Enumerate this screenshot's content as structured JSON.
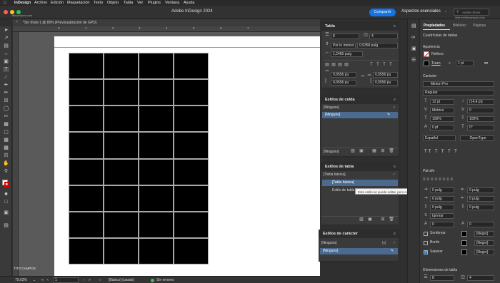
{
  "menubar": {
    "apple": "",
    "items": [
      "InDesign",
      "Archivo",
      "Edición",
      "Maquetación",
      "Texto",
      "Objeto",
      "Tabla",
      "Ver",
      "Plugins",
      "Ventana",
      "Ayuda"
    ]
  },
  "appbar": {
    "title": "Adobe InDesign 2024",
    "share_label": "Compartir",
    "workspace_label": "Aspectos esenciales",
    "search_placeholder": "Adobe Stock",
    "watermark_left": "titocampos.com",
    "watermark_right": "linkt.ee/titocampos.com"
  },
  "document_tab": {
    "label": "*Sin título-1 @ 80% [Previsualización de GPU]"
  },
  "ruler": {
    "marks": [
      "0",
      "1",
      "2",
      "3",
      "4",
      "5",
      "6",
      "7"
    ]
  },
  "table_grid": {
    "rows": 8,
    "columns": 4
  },
  "page": {
    "footer_text": "TITO CAMPOS"
  },
  "status": {
    "zoom": "79,63%",
    "page": "1",
    "style": "[Básico] (usado)",
    "preflight": "Sin errores"
  },
  "tabla_panel": {
    "title": "Tabla",
    "rows_value": "8",
    "cols_value": "4",
    "row_height_mode": "Por lo menos",
    "row_height_value": "0,9358 pulg",
    "col_width_value": "1,2465 pulg",
    "inset_top": "0,0556 pu",
    "inset_bottom": "0,0556 pu",
    "inset_left": "0,0556 pu",
    "inset_right": "0,0556 pu"
  },
  "cell_styles_panel": {
    "title": "Estilos de celda",
    "current": "[Ninguno]",
    "selected_item": "[Ninguno]",
    "footer_value": "[Ninguno]"
  },
  "table_styles_panel": {
    "title": "Estilos de tabla",
    "current": "[Tabla básica]",
    "selected_item": "[Tabla básica]",
    "item2": "Estilo de tabla 1",
    "tooltip": "Este estilo se puede editar, pero no quitar."
  },
  "char_styles_panel": {
    "title": "Estilos de carácter",
    "current": "[Ninguno]",
    "selected_item": "[Ninguno]",
    "shortcut": "[x]"
  },
  "properties": {
    "tabs": [
      "Propiedades",
      "Bibliotec",
      "Páginas"
    ],
    "context_label": "Cuadrículas de tablas",
    "appearance_heading": "Apariencia",
    "fill_label": "Relleno",
    "stroke_label": "Trazo",
    "stroke_weight": "1 pt",
    "character_heading": "Carácter",
    "font_family": "Minion Pro",
    "font_style": "Regular",
    "font_size": "12 pt",
    "leading": "(14,4 pt)",
    "kerning": "Métrico",
    "tracking": "0",
    "vertical_scale": "100%",
    "horizontal_scale": "100%",
    "baseline_shift": "0 pt",
    "skew": "0°",
    "language": "Español",
    "opentype_label": "OpenType",
    "paragraph_heading": "Párrafo",
    "indent_left": "0 pulg",
    "indent_right": "0 pulg",
    "first_line": "0 pulg",
    "last_line": "0 pulg",
    "space_before": "0 pulg",
    "space_after": "0 pulg",
    "hyphenation": "Ignorar",
    "drop_lines": "0",
    "drop_chars": "0",
    "shading_label": "Sombrear",
    "shading_swatch": "[Negro]",
    "border_label": "Borde",
    "border_swatch": "[Negro]",
    "separate_label": "Separar",
    "separate_swatch": "[Negro]",
    "table_dims_heading": "Dimensiones de tabla",
    "dims_rows": "8",
    "dims_cols": "4"
  },
  "colors": {
    "accent": "#1473e6",
    "selection": "#4a6a8f",
    "panel_bg": "#3a3a3a",
    "pasteboard": "#5a5a5a"
  }
}
